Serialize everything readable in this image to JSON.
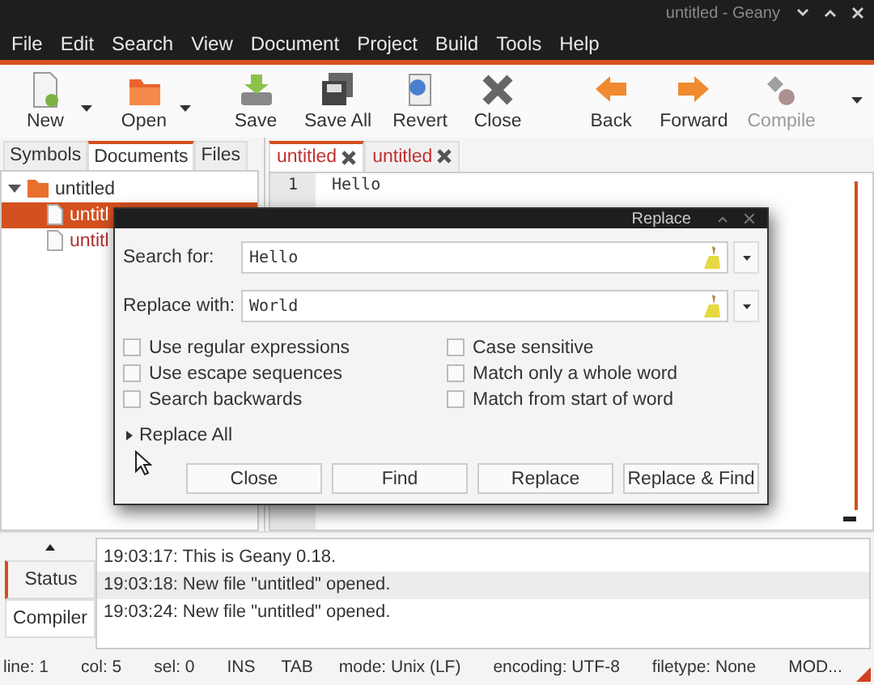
{
  "window": {
    "title": "untitled - Geany"
  },
  "menu": [
    "File",
    "Edit",
    "Search",
    "View",
    "Document",
    "Project",
    "Build",
    "Tools",
    "Help"
  ],
  "toolbar": [
    {
      "kind": "new",
      "label": "New",
      "dropdown": true,
      "disabled": false
    },
    {
      "kind": "open",
      "label": "Open",
      "dropdown": true,
      "disabled": false
    },
    {
      "kind": "save",
      "label": "Save",
      "dropdown": false,
      "disabled": false
    },
    {
      "kind": "saveall",
      "label": "Save All",
      "dropdown": false,
      "disabled": false
    },
    {
      "kind": "revert",
      "label": "Revert",
      "dropdown": false,
      "disabled": false
    },
    {
      "kind": "close",
      "label": "Close",
      "dropdown": false,
      "disabled": false
    },
    {
      "kind": "back",
      "label": "Back",
      "dropdown": false,
      "disabled": false
    },
    {
      "kind": "forward",
      "label": "Forward",
      "dropdown": false,
      "disabled": false
    },
    {
      "kind": "compile",
      "label": "Compile",
      "dropdown": false,
      "disabled": true
    }
  ],
  "sidebar": {
    "tabs": [
      {
        "label": "Symbols",
        "selected": false
      },
      {
        "label": "Documents",
        "selected": true
      },
      {
        "label": "Files",
        "selected": false
      }
    ],
    "tree": [
      {
        "label": "untitled",
        "expanded": true,
        "children": [
          {
            "label": "untitl",
            "selected": true
          },
          {
            "label": "untitl",
            "selected": false
          }
        ]
      }
    ]
  },
  "editor": {
    "tabs": [
      {
        "label": "untitled",
        "selected": true
      },
      {
        "label": "untitled",
        "selected": false
      }
    ],
    "lines": [
      {
        "number": "1",
        "text": "Hello"
      }
    ]
  },
  "dialog": {
    "title": "Replace",
    "fields": [
      {
        "label": "Search for:",
        "value": "Hello"
      },
      {
        "label": "Replace with:",
        "value": "World"
      }
    ],
    "options": [
      {
        "label": "Use regular expressions",
        "checked": false
      },
      {
        "label": "Case sensitive",
        "checked": false
      },
      {
        "label": "Use escape sequences",
        "checked": false
      },
      {
        "label": "Match only a whole word",
        "checked": false
      },
      {
        "label": "Search backwards",
        "checked": false
      },
      {
        "label": "Match from start of word",
        "checked": false
      }
    ],
    "expander": {
      "label": "Replace All",
      "expanded": false
    },
    "buttons": [
      "Close",
      "Find",
      "Replace",
      "Replace & Find"
    ]
  },
  "messages": {
    "tabs": [
      {
        "label": "Status",
        "selected": true
      },
      {
        "label": "Compiler",
        "selected": false
      }
    ],
    "rows": [
      {
        "text": "19:03:17: This is Geany 0.18.",
        "selected": false
      },
      {
        "text": "19:03:18: New file \"untitled\" opened.",
        "selected": true
      },
      {
        "text": "19:03:24: New file \"untitled\" opened.",
        "selected": false
      }
    ]
  },
  "status_bar": [
    "line: 1",
    "col: 5",
    "sel: 0",
    "INS",
    "TAB",
    "mode: Unix (LF)",
    "encoding: UTF-8",
    "filetype: None",
    "MOD..."
  ]
}
